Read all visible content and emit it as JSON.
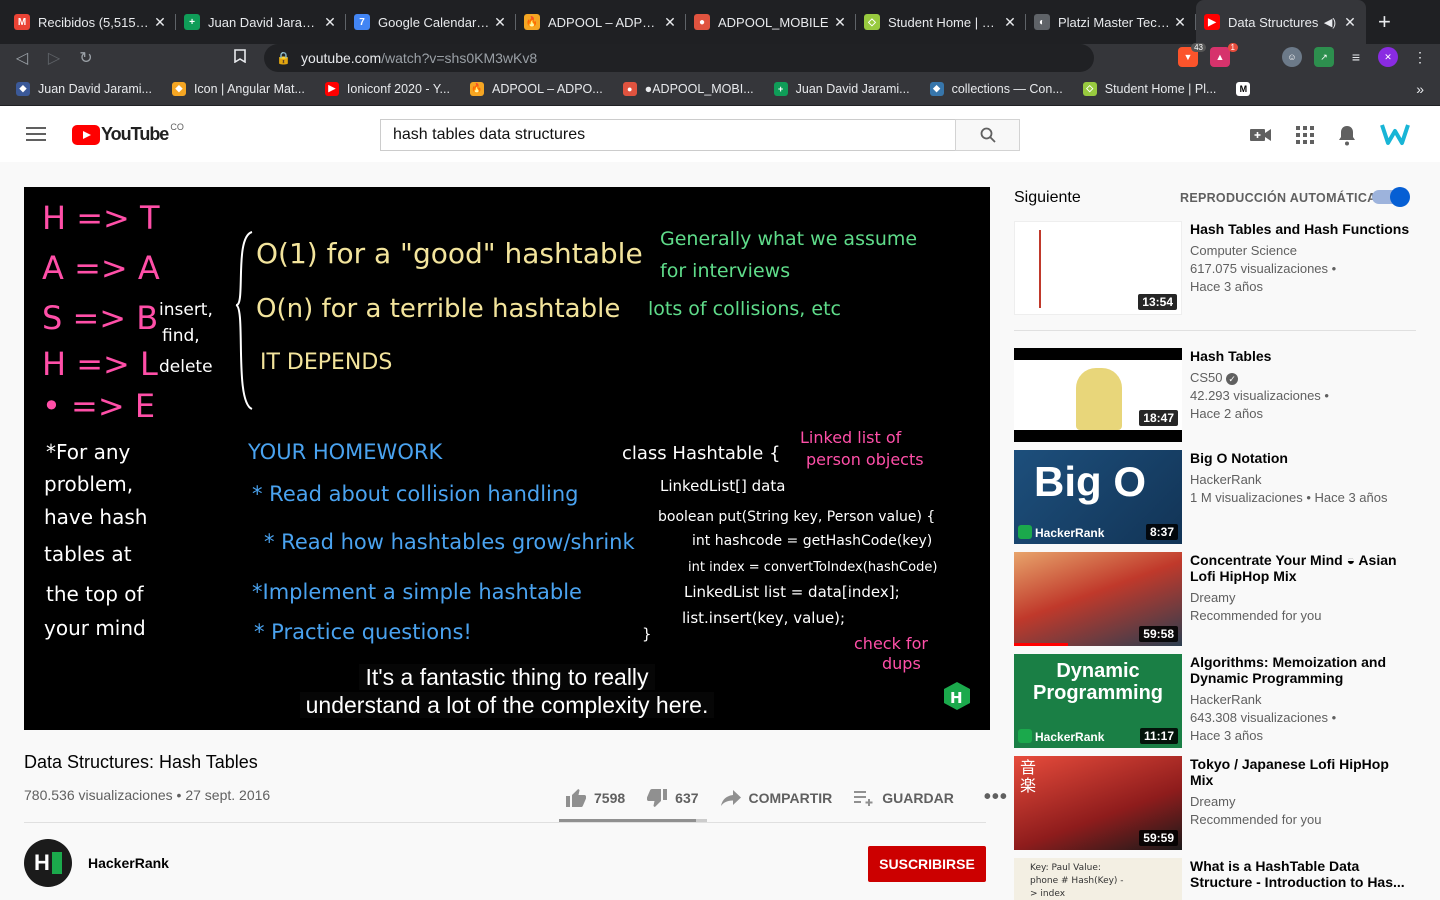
{
  "browser": {
    "tabs": [
      {
        "title": "Recibidos (5,515) - juandavid",
        "fav_color": "#ea4335",
        "fav_text": "M"
      },
      {
        "title": "Juan David Jaramillo",
        "fav_color": "#0f9d58",
        "fav_text": "+"
      },
      {
        "title": "Google Calendario - Semana",
        "fav_color": "#4285f4",
        "fav_text": "7"
      },
      {
        "title": "ADPOOL – ADPOOL",
        "fav_color": "#f5a623",
        "fav_text": "🔥"
      },
      {
        "title": "ADPOOL_MOBILE",
        "fav_color": "#e0533f",
        "fav_text": "●"
      },
      {
        "title": "Student Home | Platzi",
        "fav_color": "#98ca3f",
        "fav_text": "◇"
      },
      {
        "title": "Platzi Master Technical",
        "fav_color": "#5f6368",
        "fav_text": "◐"
      },
      {
        "title": "Data Structures",
        "fav_color": "#ff0000",
        "fav_text": "▶"
      }
    ],
    "new_tab": "+",
    "url_host": "youtube.com",
    "url_path": "/watch?v=shs0KM3wKv8",
    "ext_badges": [
      "43",
      "1"
    ],
    "bookmarks": [
      {
        "label": "Juan David Jarami...",
        "fav_color": "#3b5998",
        "fav_text": "◆"
      },
      {
        "label": "Icon | Angular Mat...",
        "fav_color": "#f5a623",
        "fav_text": "◆"
      },
      {
        "label": "Ioniconf 2020 - Y...",
        "fav_color": "#ff0000",
        "fav_text": "▶"
      },
      {
        "label": "ADPOOL – ADPO...",
        "fav_color": "#f5a623",
        "fav_text": "🔥"
      },
      {
        "label": "●ADPOOL_MOBI...",
        "fav_color": "#e0533f",
        "fav_text": "●"
      },
      {
        "label": "Juan David Jarami...",
        "fav_color": "#0f9d58",
        "fav_text": "+"
      },
      {
        "label": "collections — Con...",
        "fav_color": "#3776ab",
        "fav_text": "◆"
      },
      {
        "label": "Student Home | Pl...",
        "fav_color": "#98ca3f",
        "fav_text": "◇"
      },
      {
        "label": "",
        "fav_color": "#ffffff",
        "fav_text": "M"
      }
    ],
    "bookmarks_more": "»"
  },
  "youtube": {
    "logo_text": "YouTube",
    "country": "CO",
    "search_value": "hash tables data structures",
    "video": {
      "captions": [
        "It's a fantastic thing to really",
        "understand a lot of the complexity here."
      ],
      "board_left": [
        "H => T",
        "A => A",
        "S => B",
        "H => L",
        "• => E"
      ],
      "board_ops": [
        "insert,",
        "find,",
        "delete"
      ],
      "board_big_o": [
        "O(1) for a \"good\" hashtable",
        "O(n) for a terrible hashtable",
        "IT DEPENDS"
      ],
      "board_notes_green": [
        "Generally what we assume",
        "for interviews",
        "lots of collisions, etc"
      ],
      "board_left_note": [
        "*For any",
        "problem,",
        "have hash",
        "tables at",
        "the top of",
        "your mind"
      ],
      "homework_title": "YOUR HOMEWORK",
      "homework": [
        "* Read about collision handling",
        "* Read how hashtables grow/shrink",
        "*Implement a simple hashtable",
        "* Practice questions!"
      ],
      "code": [
        "class Hashtable {",
        "LinkedList[] data",
        "boolean put(String key, Person value) {",
        "int hashcode = getHashCode(key)",
        "int index = convertToIndex(hashCode)",
        "LinkedList list = data[index];",
        "list.insert(key, value);",
        "}"
      ],
      "pink_notes": [
        "Linked list of",
        "person objects",
        "check for",
        "dups"
      ],
      "watermark": "H"
    },
    "title": "Data Structures: Hash Tables",
    "views_date": "780.536 visualizaciones • 27 sept. 2016",
    "likes": "7598",
    "dislikes": "637",
    "share": "COMPARTIR",
    "save": "GUARDAR",
    "like_ratio": 0.923,
    "channel": {
      "name": "HackerRank",
      "avatar": "H"
    },
    "subscribe": "SUSCRIBIRSE",
    "sidebar": {
      "next_label": "Siguiente",
      "autoplay_label": "REPRODUCCIÓN AUTOMÁTICA",
      "autoplay_on": true,
      "items": [
        {
          "title": "Hash Tables and Hash Functions",
          "channel": "Computer Science",
          "line1": "617.075 visualizaciones •",
          "line2": "Hace 3 años",
          "duration": "13:54",
          "thumb": "white"
        },
        {
          "title": "Hash Tables",
          "channel": "CS50",
          "line1": "42.293 visualizaciones •",
          "line2": "Hace 2 años",
          "duration": "18:47",
          "thumb": "cs50"
        },
        {
          "title": "Big O Notation",
          "channel": "HackerRank",
          "line1": "1 M visualizaciones • Hace 3 años",
          "line2": "",
          "duration": "8:37",
          "thumb": "bigo",
          "thumb_text": "Big O",
          "thumb_brand": "HackerRank"
        },
        {
          "title": "Concentrate Your Mind ◒ Asian Lofi HipHop Mix",
          "channel": "Dreamy",
          "line1": "Recommended for you",
          "line2": "",
          "duration": "59:58",
          "thumb": "lofi1"
        },
        {
          "title": "Algorithms: Memoization and Dynamic Programming",
          "channel": "HackerRank",
          "line1": "643.308 visualizaciones •",
          "line2": "Hace 3 años",
          "duration": "11:17",
          "thumb": "dp",
          "thumb_text": "Dynamic Programming",
          "thumb_brand": "HackerRank"
        },
        {
          "title": "Tokyo / Japanese Lofi HipHop Mix",
          "channel": "Dreamy",
          "line1": "Recommended for you",
          "line2": "",
          "duration": "59:59",
          "thumb": "lofi2",
          "thumb_text": "音楽"
        },
        {
          "title": "What is a HashTable Data Structure - Introduction to Has...",
          "channel": "",
          "line1": "",
          "line2": "",
          "duration": "",
          "thumb": "paper",
          "thumb_text": "Key: Paul  Value: phone #  Hash(Key) -> index"
        }
      ]
    }
  }
}
